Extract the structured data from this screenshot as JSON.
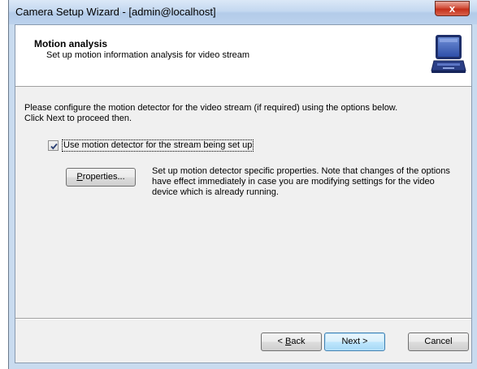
{
  "window": {
    "title": "Camera Setup Wizard - [admin@localhost]",
    "close_glyph": "x"
  },
  "header": {
    "title": "Motion analysis",
    "subtitle": "Set up motion information analysis for video stream",
    "icon": "laptop-icon"
  },
  "body": {
    "instruction_line1": "Please configure the motion detector for the video stream (if required) using the options below.",
    "instruction_line2": "Click Next to proceed then.",
    "use_motion_detector": {
      "label": "Use motion detector for the stream being set up",
      "checked": true
    },
    "properties_button": {
      "mnemonic": "P",
      "rest": "roperties..."
    },
    "properties_description": "Set up motion detector specific properties. Note that changes of the options have effect immediately in case you are modifying settings for the video device which is already running."
  },
  "footer": {
    "back_prefix": "< ",
    "back_mnemonic": "B",
    "back_rest": "ack",
    "next_label": "Next >",
    "cancel_label": "Cancel"
  },
  "colors": {
    "titlebar": "#c4d8f0",
    "close_button": "#c4301b",
    "default_button_border": "#3c7fb1"
  }
}
